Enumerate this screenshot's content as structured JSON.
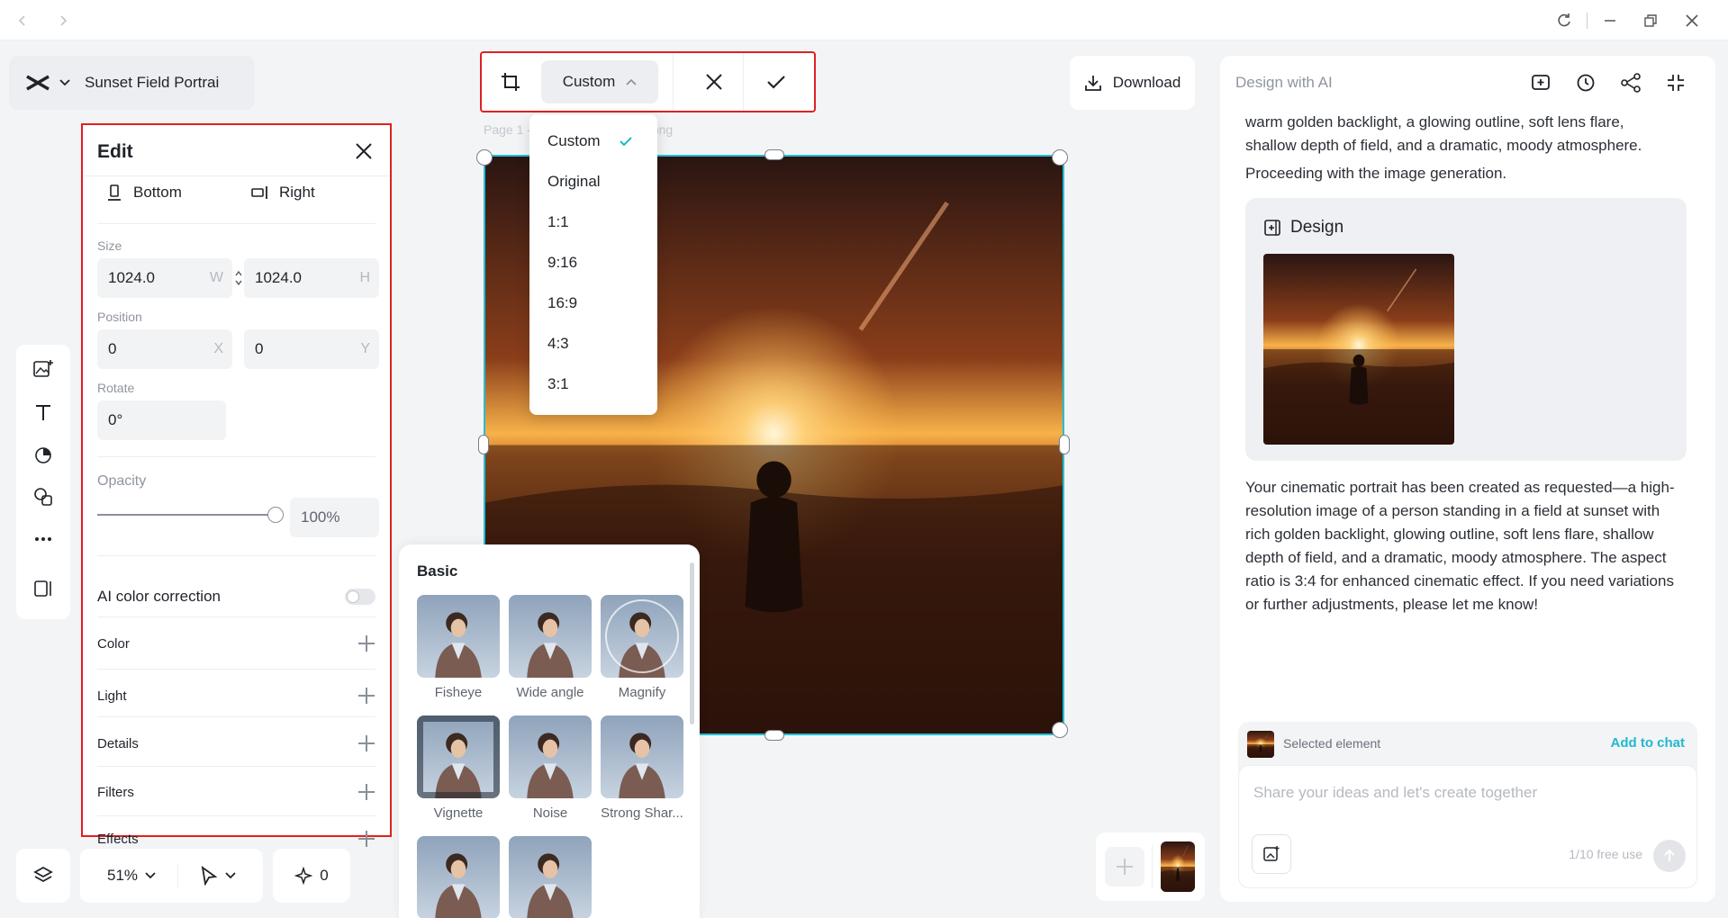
{
  "project": {
    "name": "Sunset Field Portrai"
  },
  "edit_panel": {
    "title": "Edit",
    "align": {
      "bottom": "Bottom",
      "right": "Right"
    },
    "size": {
      "label": "Size",
      "width": "1024.0",
      "width_suffix": "W",
      "height": "1024.0",
      "height_suffix": "H"
    },
    "position": {
      "label": "Position",
      "x": "0",
      "x_suffix": "X",
      "y": "0",
      "y_suffix": "Y"
    },
    "rotate": {
      "label": "Rotate",
      "value": "0°"
    },
    "opacity": {
      "label": "Opacity",
      "value": "100%",
      "level": 1.0
    },
    "ai_color_correction": {
      "label": "AI color correction",
      "enabled": false
    },
    "rows": [
      "Color",
      "Light",
      "Details",
      "Filters",
      "Effects"
    ]
  },
  "crop_toolbar": {
    "aspect_label": "Custom",
    "options": [
      "Custom",
      "Original",
      "1:1",
      "9:16",
      "16:9",
      "4:3",
      "3:1"
    ],
    "selected": "Custom"
  },
  "canvas": {
    "page_label": "Page 1 - sunset_field_portrait.png"
  },
  "filters": {
    "title": "Basic",
    "items": [
      "Fisheye",
      "Wide angle",
      "Magnify",
      "Vignette",
      "Noise",
      "Strong Shar..."
    ]
  },
  "bottom_bar": {
    "zoom": "51%",
    "credits": "0"
  },
  "download": {
    "label": "Download"
  },
  "ai_panel": {
    "header": "Design with AI",
    "intro_lines": [
      "warm golden backlight, a glowing outline, soft lens flare,",
      "shallow depth of field, and a dramatic, moody atmosphere.",
      "Proceeding with the image generation."
    ],
    "design_card_title": "Design",
    "response": "Your cinematic portrait has been created as requested—a high-resolution image of a person standing in a field at sunset with rich golden backlight, glowing outline, soft lens flare, shallow depth of field, and a dramatic, moody atmosphere. The aspect ratio is 3:4 for enhanced cinematic effect. If you need variations or further adjustments, please let me know!",
    "selected_element": "Selected element",
    "add_to_chat": "Add to chat",
    "input_placeholder": "Share your ideas and let's create together",
    "free_use": "1/10 free use"
  },
  "colors": {
    "accent": "#20c0d8",
    "highlight": "#e02020"
  }
}
